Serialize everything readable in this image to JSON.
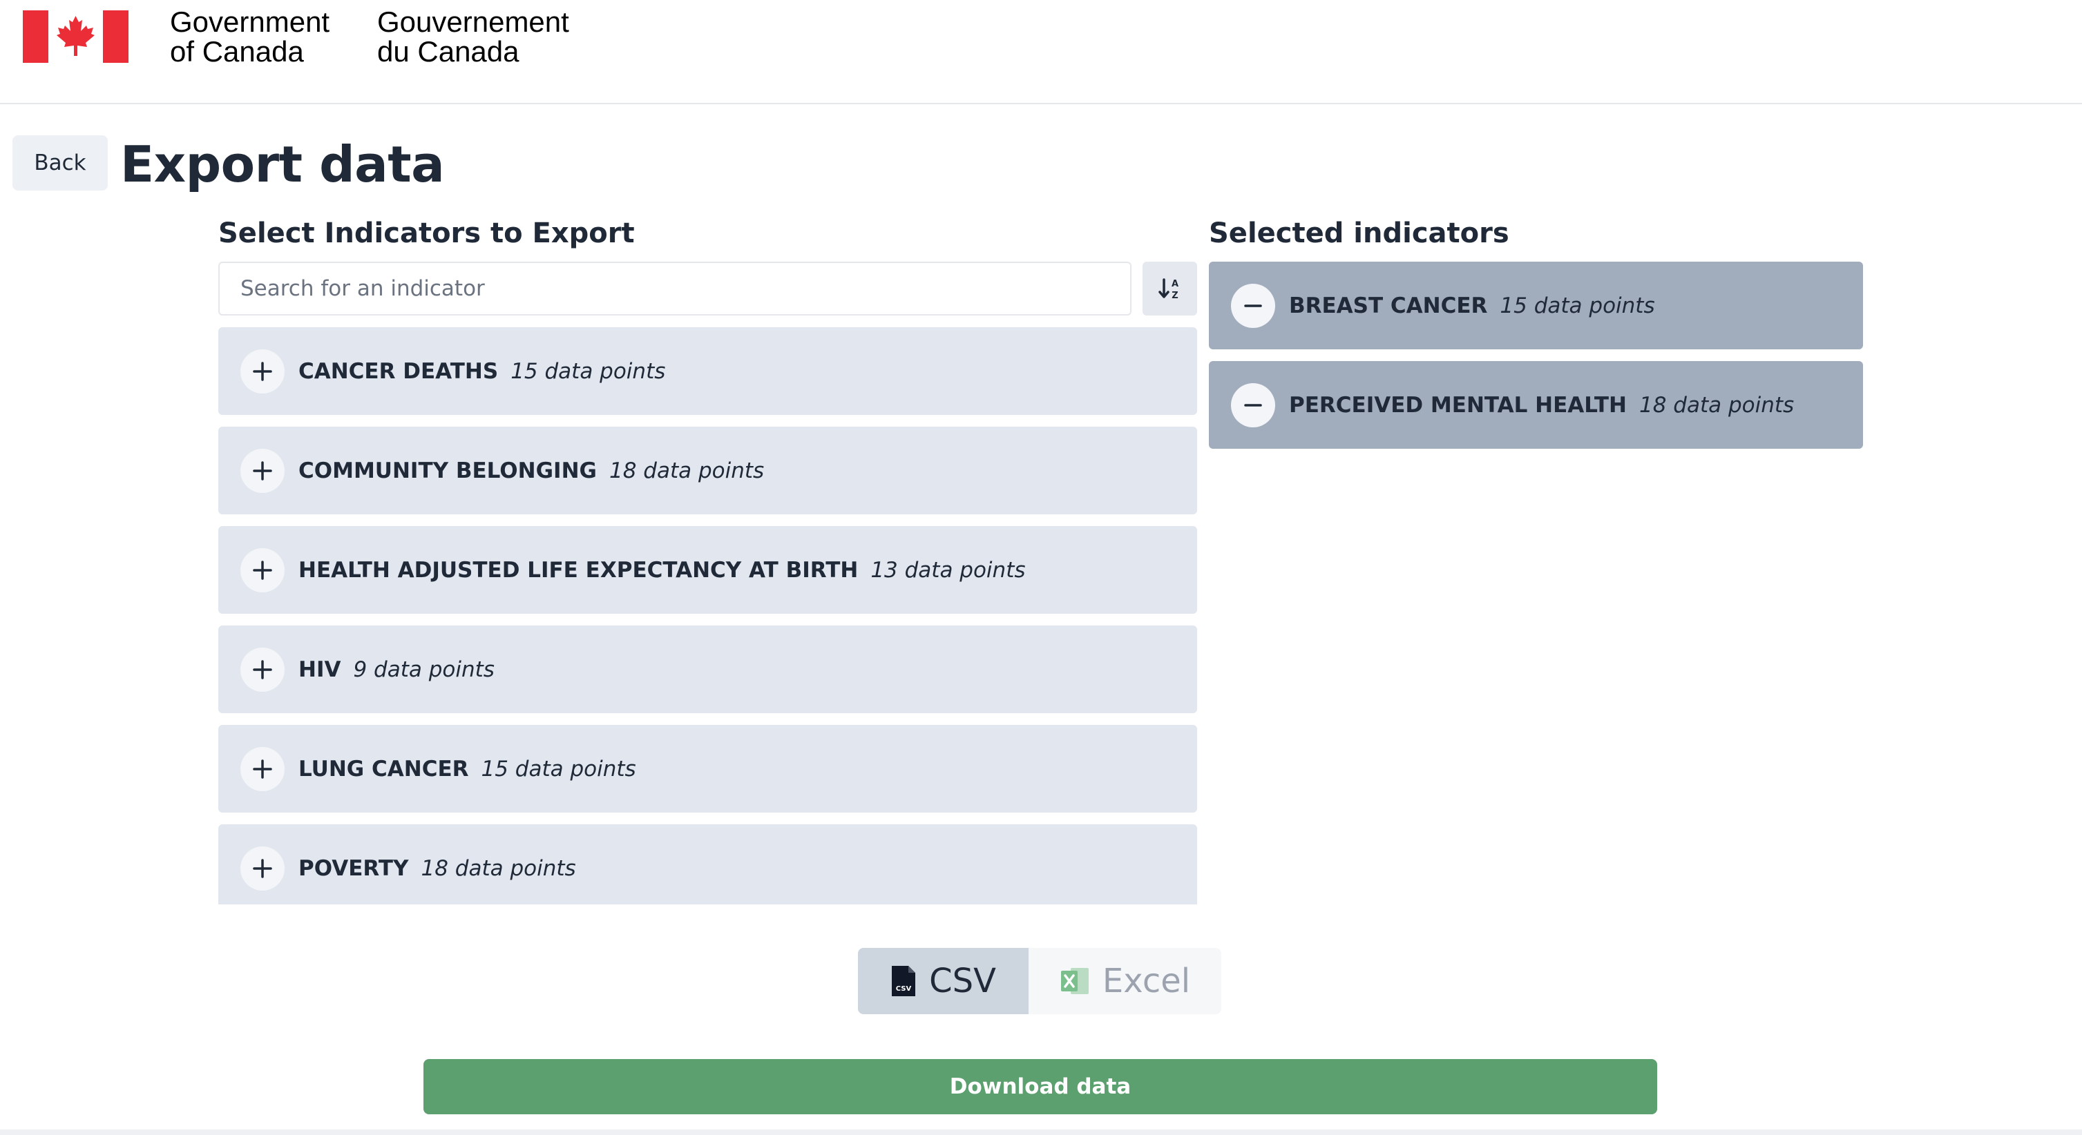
{
  "header": {
    "wordmark_en_line1": "Government",
    "wordmark_en_line2": "of Canada",
    "wordmark_fr_line1": "Gouvernement",
    "wordmark_fr_line2": "du Canada",
    "flag_icon": "canada-flag-icon",
    "flag_color": "#eb2d37"
  },
  "page": {
    "back_label": "Back",
    "title": "Export data"
  },
  "available": {
    "heading": "Select Indicators to Export",
    "search_placeholder": "Search for an indicator",
    "search_value": "",
    "sort_icon": "sort-alpha-icon",
    "items": [
      {
        "name": "CANCER DEATHS",
        "count": "15 data points"
      },
      {
        "name": "COMMUNITY BELONGING",
        "count": "18 data points"
      },
      {
        "name": "HEALTH ADJUSTED LIFE EXPECTANCY AT BIRTH",
        "count": "13 data points"
      },
      {
        "name": "HIV",
        "count": "9 data points"
      },
      {
        "name": "LUNG CANCER",
        "count": "15 data points"
      },
      {
        "name": "POVERTY",
        "count": "18 data points"
      }
    ]
  },
  "selected": {
    "heading": "Selected indicators",
    "items": [
      {
        "name": "BREAST CANCER",
        "count": "15 data points"
      },
      {
        "name": "PERCEIVED MENTAL HEALTH",
        "count": "18 data points"
      }
    ]
  },
  "format": {
    "csv_label": "CSV",
    "excel_label": "Excel",
    "selected": "CSV",
    "excel_color": "#7bbf8d"
  },
  "download_label": "Download data",
  "colors": {
    "download_green": "#5ba06e",
    "available_item_bg": "#e2e7ef",
    "selected_item_bg": "#a1adbd"
  }
}
